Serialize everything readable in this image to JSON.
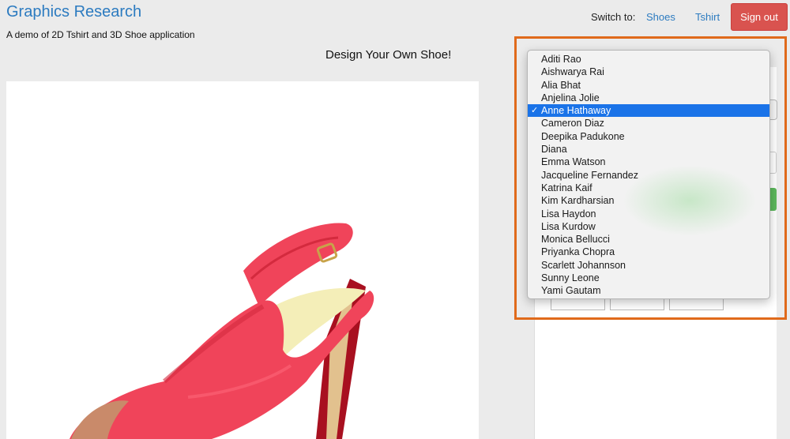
{
  "header": {
    "brand": "Graphics Research",
    "subtitle": "A demo of 2D Tshirt and 3D Shoe application",
    "switch_label": "Switch to:",
    "nav": [
      {
        "label": "Shoes"
      },
      {
        "label": "Tshirt"
      }
    ],
    "signout_label": "Sign out"
  },
  "main": {
    "heading": "Design Your Own Shoe!"
  },
  "shoe": {
    "body_color": "#f0445a",
    "shade_color": "#d42a3e",
    "heel_color": "#a81020",
    "insole_color": "#f4eeb8",
    "buckle_color": "#c8a34a"
  },
  "dropdown": {
    "selected_index": 4,
    "options": [
      "Aditi Rao",
      "Aishwarya Rai",
      "Alia Bhat",
      "Anjelina Jolie",
      "Anne Hathaway",
      "Cameron Diaz",
      "Deepika Padukone",
      "Diana",
      "Emma Watson",
      "Jacqueline Fernandez",
      "Katrina Kaif",
      "Kim Kardharsian",
      "Lisa Haydon",
      "Lisa Kurdow",
      "Monica Bellucci",
      "Priyanka Chopra",
      "Scarlett Johannson",
      "Sunny Leone",
      "Yami Gautam"
    ],
    "check_glyph": "✓",
    "accent_color": "#1a73e8",
    "frame_color": "#e06a1b"
  }
}
